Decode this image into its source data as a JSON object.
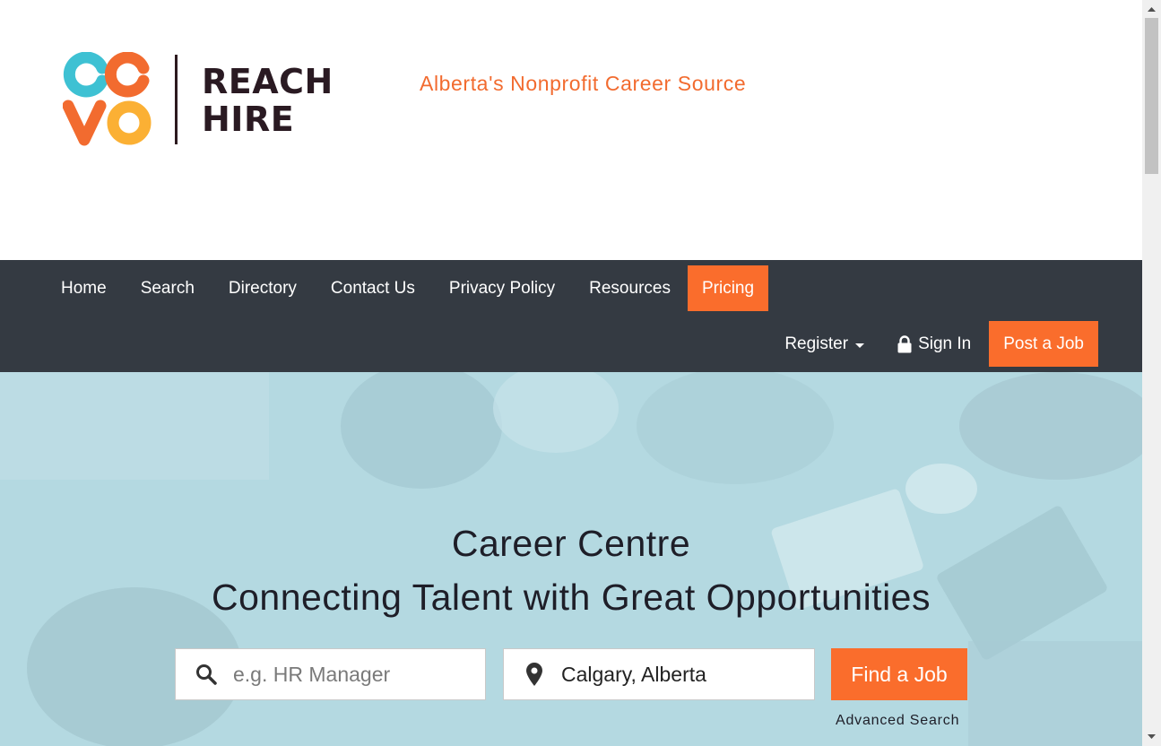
{
  "header": {
    "logo": {
      "mark_letters": [
        "C",
        "C",
        "V",
        "O"
      ],
      "text_line1": "REACH",
      "text_line2": "HIRE"
    },
    "tagline": "Alberta's Nonprofit Career Source"
  },
  "nav": {
    "primary": [
      {
        "label": "Home"
      },
      {
        "label": "Search"
      },
      {
        "label": "Directory"
      },
      {
        "label": "Contact Us"
      },
      {
        "label": "Privacy Policy"
      },
      {
        "label": "Resources"
      },
      {
        "label": "Pricing",
        "active": true
      }
    ],
    "register_label": "Register",
    "signin_label": "Sign In",
    "post_job_label": "Post a Job"
  },
  "hero": {
    "title": "Career Centre",
    "subtitle": "Connecting Talent with Great Opportunities",
    "keyword": {
      "placeholder": "e.g. HR Manager",
      "value": ""
    },
    "location": {
      "value": "Calgary, Alberta"
    },
    "find_button": "Find a Job",
    "advanced_search": "Advanced Search"
  },
  "colors": {
    "accent": "#fa6d2c",
    "navbar": "#343a42",
    "hero_tint": "#b4d9e1",
    "logo_teal": "#3ec1d3",
    "logo_orange": "#f26b2f",
    "logo_yellow": "#fbb034"
  }
}
